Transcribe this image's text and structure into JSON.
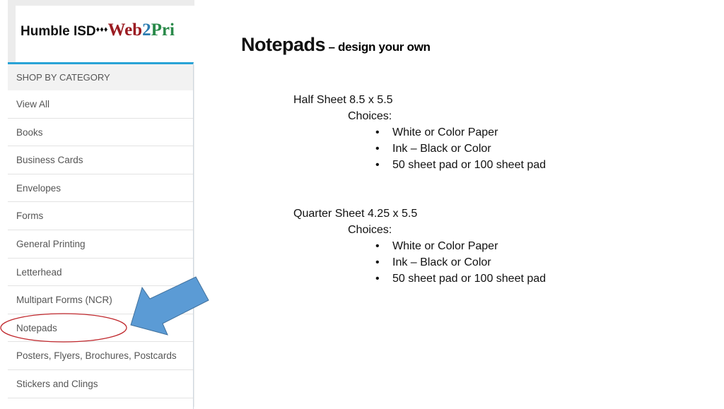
{
  "logo": {
    "part1": "Humble ISD",
    "diamonds": "♦♦♦",
    "web": "Web",
    "two": "2",
    "pri": "Pri"
  },
  "sidebar": {
    "header": "SHOP BY CATEGORY",
    "items": [
      "View All",
      "Books",
      "Business Cards",
      "Envelopes",
      "Forms",
      "General Printing",
      "Letterhead",
      "Multipart Forms (NCR)",
      "Notepads",
      "Posters, Flyers, Brochures, Postcards",
      "Stickers and Clings"
    ],
    "highlighted": "Notepads"
  },
  "main": {
    "title": "Notepads",
    "subtitle": "– design your own",
    "sections": [
      {
        "heading": "Half Sheet 8.5 x 5.5",
        "choices_label": "Choices:",
        "bullets": [
          "White or Color Paper",
          "Ink – Black or Color",
          "50 sheet pad or 100 sheet pad"
        ]
      },
      {
        "heading": "Quarter Sheet 4.25 x 5.5",
        "choices_label": "Choices:",
        "bullets": [
          "White or Color Paper",
          "Ink – Black or Color",
          "50 sheet pad or 100 sheet pad"
        ]
      }
    ]
  },
  "colors": {
    "arrow": "#5b9bd5",
    "circle": "#c0282d",
    "accent": "#29a3d6"
  }
}
